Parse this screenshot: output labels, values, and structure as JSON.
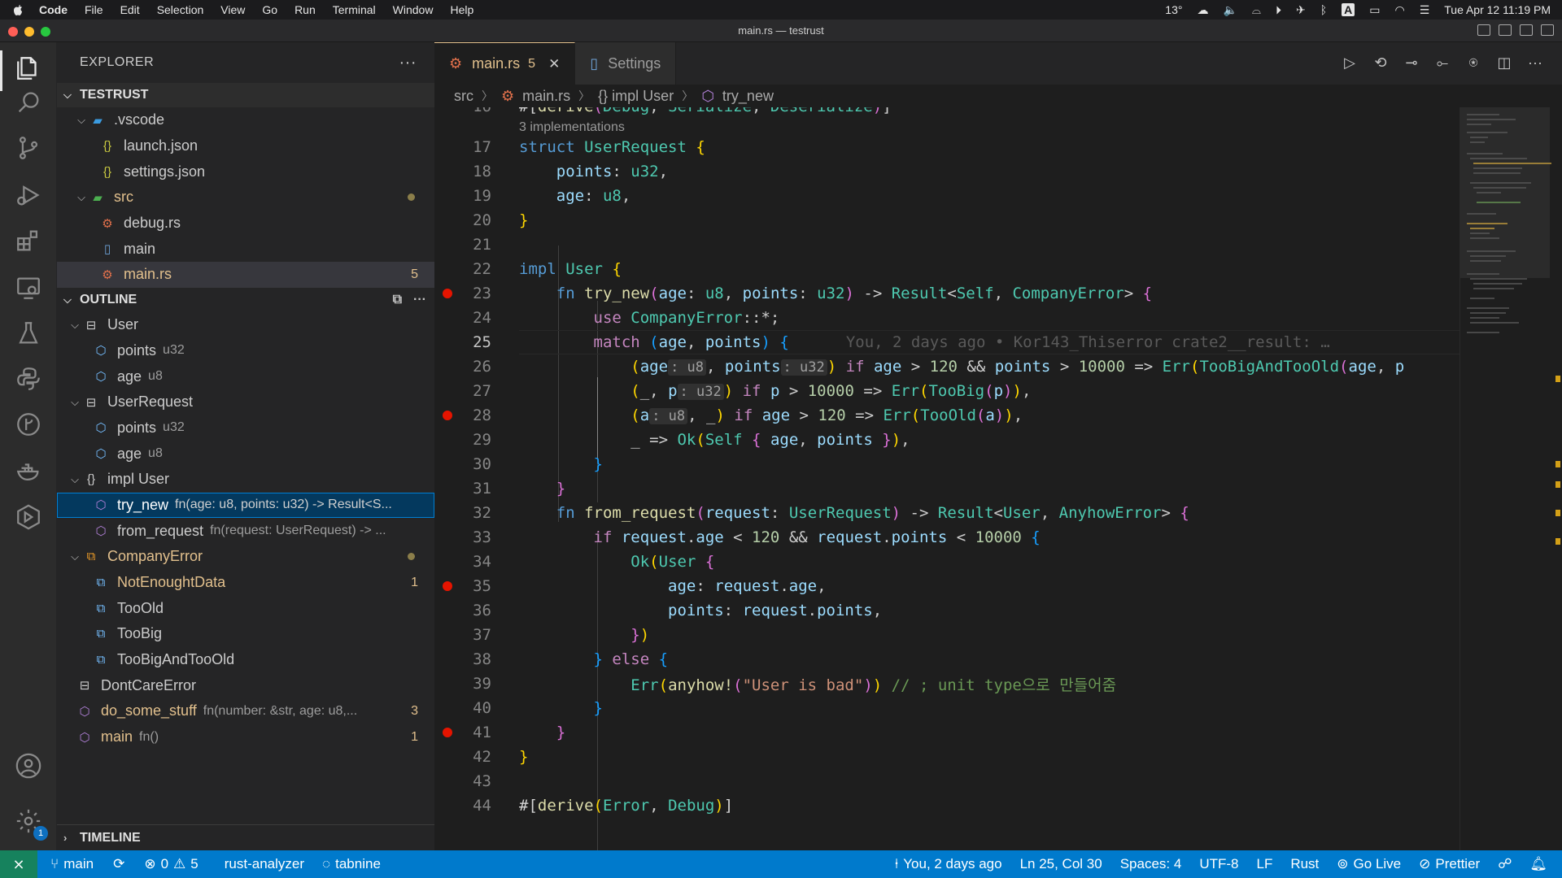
{
  "menubar": {
    "app": "Code",
    "items": [
      "File",
      "Edit",
      "Selection",
      "View",
      "Go",
      "Run",
      "Terminal",
      "Window",
      "Help"
    ],
    "temperature": "13°",
    "datetime": "Tue Apr 12  11:19 PM"
  },
  "window": {
    "title": "main.rs — testrust"
  },
  "sidebar": {
    "title": "EXPLORER",
    "project": "TESTRUST",
    "files": [
      {
        "label": ".vscode",
        "type": "folder"
      },
      {
        "label": "launch.json",
        "type": "json"
      },
      {
        "label": "settings.json",
        "type": "json"
      },
      {
        "label": "src",
        "type": "folder",
        "modified": true
      },
      {
        "label": "debug.rs",
        "type": "rust"
      },
      {
        "label": "main",
        "type": "file"
      },
      {
        "label": "main.rs",
        "type": "rust",
        "badge": "5"
      }
    ],
    "outline_title": "OUTLINE",
    "outline": [
      {
        "label": "User",
        "detail": "",
        "kind": "struct"
      },
      {
        "label": "points",
        "detail": "u32",
        "kind": "field"
      },
      {
        "label": "age",
        "detail": "u8",
        "kind": "field"
      },
      {
        "label": "UserRequest",
        "detail": "",
        "kind": "struct"
      },
      {
        "label": "points",
        "detail": "u32",
        "kind": "field"
      },
      {
        "label": "age",
        "detail": "u8",
        "kind": "field"
      },
      {
        "label": "impl User",
        "detail": "",
        "kind": "impl"
      },
      {
        "label": "try_new",
        "detail": "fn(age: u8, points: u32) -> Result<S...",
        "kind": "method"
      },
      {
        "label": "from_request",
        "detail": "fn(request: UserRequest) -> ...",
        "kind": "method"
      },
      {
        "label": "CompanyError",
        "detail": "",
        "kind": "enum"
      },
      {
        "label": "NotEnoughtData",
        "detail": "",
        "kind": "variant",
        "badge": "1"
      },
      {
        "label": "TooOld",
        "detail": "",
        "kind": "variant"
      },
      {
        "label": "TooBig",
        "detail": "",
        "kind": "variant"
      },
      {
        "label": "TooBigAndTooOld",
        "detail": "",
        "kind": "variant"
      },
      {
        "label": "DontCareError",
        "detail": "",
        "kind": "struct"
      },
      {
        "label": "do_some_stuff",
        "detail": "fn(number: &str, age: u8,...",
        "kind": "function",
        "badge": "3"
      },
      {
        "label": "main",
        "detail": "fn()",
        "kind": "function",
        "badge": "1"
      }
    ],
    "timeline_title": "TIMELINE"
  },
  "tabs": [
    {
      "label": "main.rs",
      "count": "5",
      "close": "✕"
    },
    {
      "label": "Settings"
    }
  ],
  "breadcrumbs": [
    "src",
    "main.rs",
    "{} impl User",
    "try_new"
  ],
  "codelens": "3 implementations",
  "blame": "You, 2 days ago • Kor143_Thiserror crate2__result: …",
  "status": {
    "branch": "main",
    "problems": "0",
    "warnings": "5",
    "analyzer": "rust-analyzer",
    "tabnine": "tabnine",
    "blame": "You, 2 days ago",
    "position": "Ln 25, Col 30",
    "spaces": "Spaces: 4",
    "encoding": "UTF-8",
    "eol": "LF",
    "language": "Rust",
    "golive": "Go Live",
    "prettier": "Prettier"
  },
  "colors": {
    "accent": "#007acc",
    "modified": "#e2c08d",
    "breakpoint": "#e51400"
  }
}
